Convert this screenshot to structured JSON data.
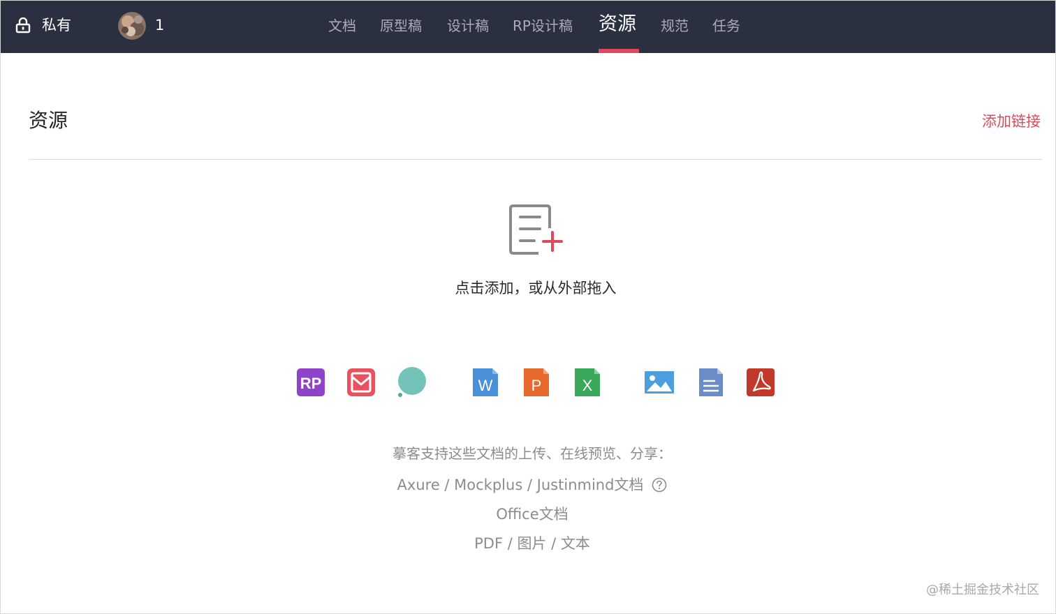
{
  "nav": {
    "visibility_label": "私有",
    "member_count": "1",
    "tabs": [
      {
        "label": "文档",
        "active": false
      },
      {
        "label": "原型稿",
        "active": false
      },
      {
        "label": "设计稿",
        "active": false
      },
      {
        "label": "RP设计稿",
        "active": false
      },
      {
        "label": "资源",
        "active": true
      },
      {
        "label": "规范",
        "active": false
      },
      {
        "label": "任务",
        "active": false
      }
    ],
    "colors": {
      "background": "#2b3040",
      "active_indicator": "#e0485b",
      "inactive_text": "#a9adb9"
    }
  },
  "page": {
    "title": "资源",
    "add_link_label": "添加链接",
    "accent_color": "#e0485b"
  },
  "empty_state": {
    "hint": "点击添加，或从外部拖入",
    "file_types": [
      {
        "icon": "axure-rp-icon",
        "color": "#8e44c9"
      },
      {
        "icon": "mockplus-icon",
        "color": "#e8525e"
      },
      {
        "icon": "justinmind-icon",
        "color": "#74c3b8"
      },
      {
        "icon": "word-icon",
        "color": "#4a90d9"
      },
      {
        "icon": "powerpoint-icon",
        "color": "#e56a2c"
      },
      {
        "icon": "excel-icon",
        "color": "#3aa85a"
      },
      {
        "icon": "image-icon",
        "color": "#4a9fdc"
      },
      {
        "icon": "text-icon",
        "color": "#6b8cc7"
      },
      {
        "icon": "pdf-icon",
        "color": "#c0392b"
      }
    ],
    "support_title": "摹客支持这些文档的上传、在线预览、分享：",
    "support_lines": [
      "Axure / Mockplus / Justinmind文档",
      "Office文档",
      "PDF / 图片 / 文本"
    ]
  },
  "watermark": "@稀土掘金技术社区"
}
